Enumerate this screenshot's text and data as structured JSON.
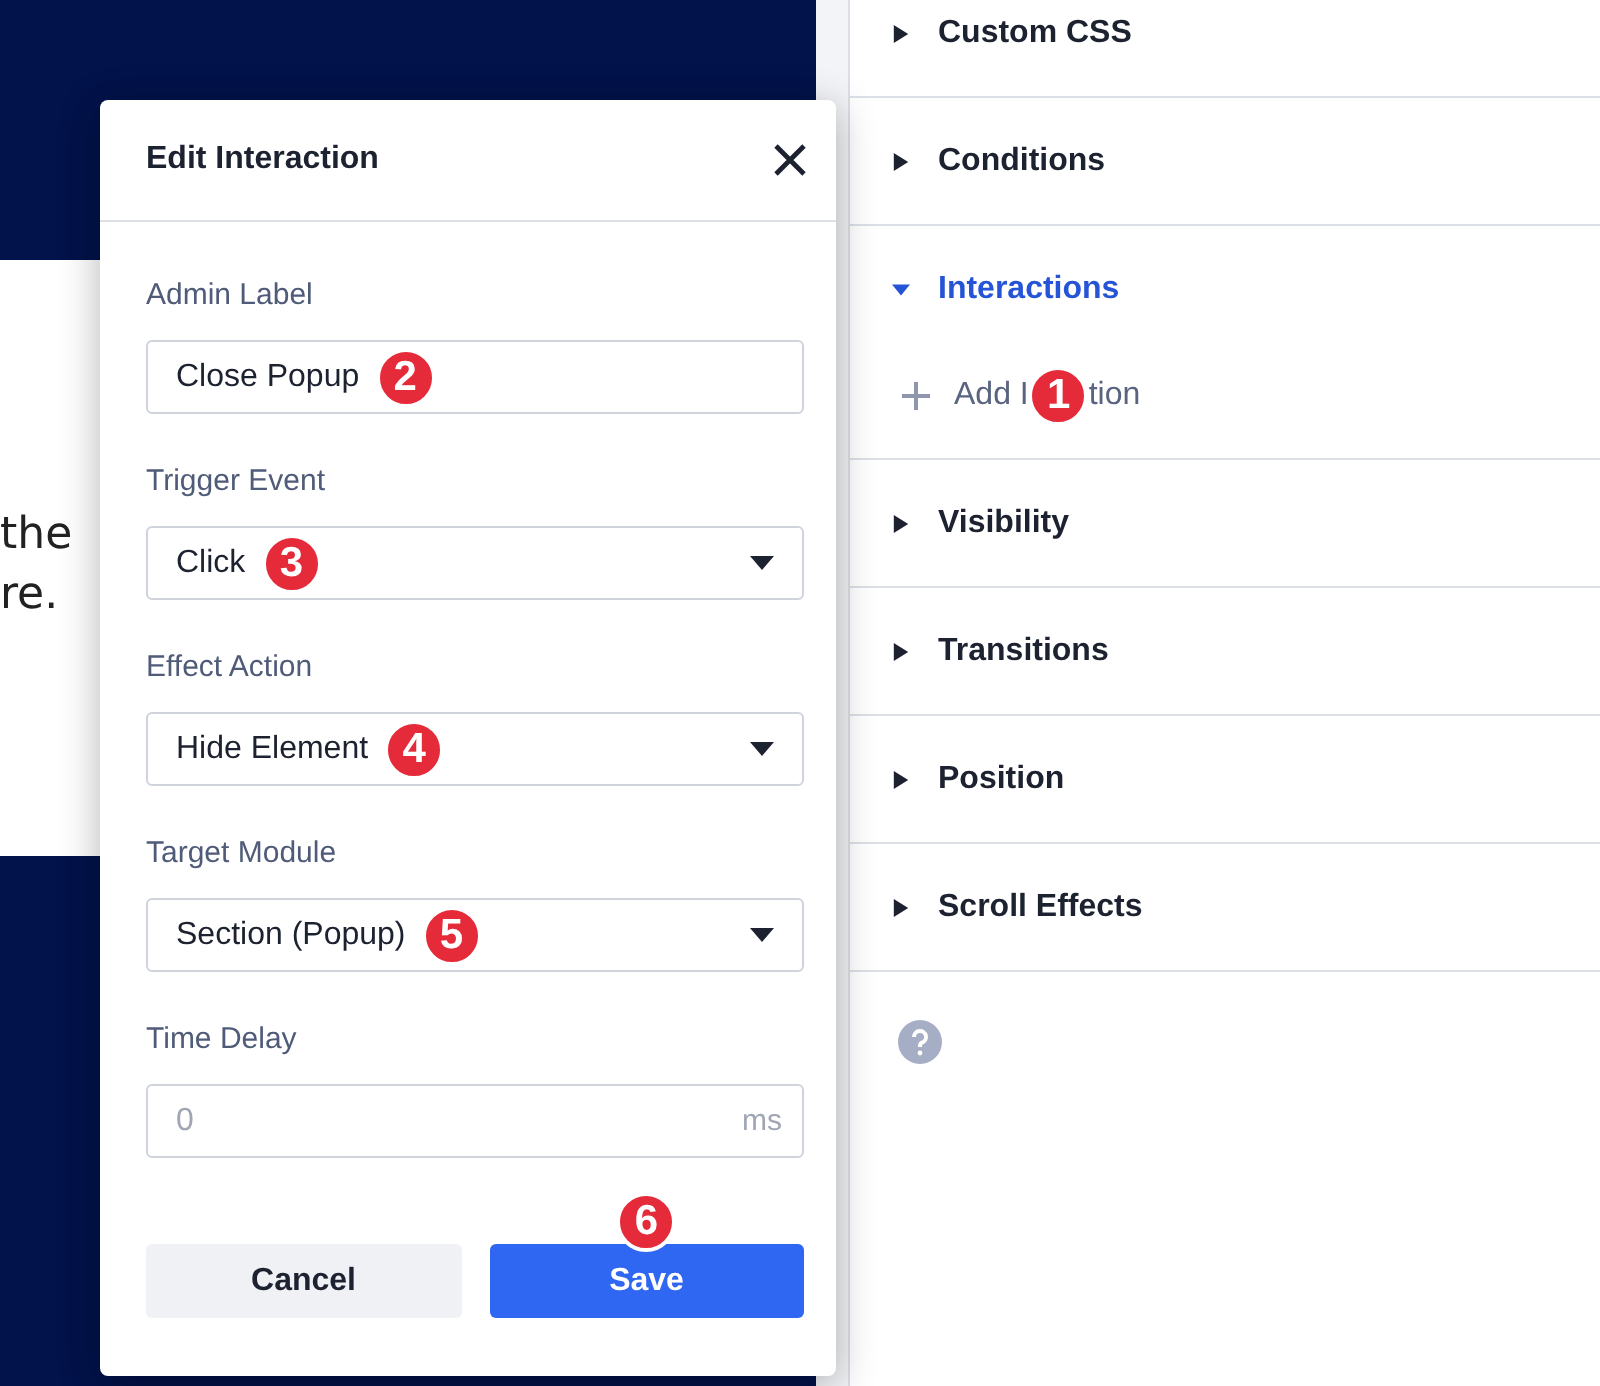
{
  "canvas": {
    "text_lines": [
      "the",
      "re."
    ]
  },
  "panel": {
    "sections": [
      {
        "label": "Custom CSS",
        "expanded": false
      },
      {
        "label": "Conditions",
        "expanded": false
      },
      {
        "label": "Interactions",
        "expanded": true,
        "add_link": {
          "label_before": "Add I",
          "label_after": "tion",
          "badge": "1"
        }
      },
      {
        "label": "Visibility",
        "expanded": false
      },
      {
        "label": "Transitions",
        "expanded": false
      },
      {
        "label": "Position",
        "expanded": false
      },
      {
        "label": "Scroll Effects",
        "expanded": false
      }
    ]
  },
  "dialog": {
    "title": "Edit Interaction",
    "fields": [
      {
        "label": "Admin Label",
        "kind": "text",
        "value": "Close Popup",
        "badge": "2"
      },
      {
        "label": "Trigger Event",
        "kind": "select",
        "value": "Click",
        "badge": "3"
      },
      {
        "label": "Effect Action",
        "kind": "select",
        "value": "Hide Element",
        "badge": "4"
      },
      {
        "label": "Target Module",
        "kind": "select",
        "value": "Section (Popup)",
        "badge": "5"
      },
      {
        "label": "Time Delay",
        "kind": "number",
        "placeholder": "0",
        "unit": "ms"
      }
    ],
    "buttons": [
      {
        "label": "Cancel",
        "kind": "secondary"
      },
      {
        "label": "Save",
        "kind": "primary",
        "badge": "6"
      }
    ]
  }
}
